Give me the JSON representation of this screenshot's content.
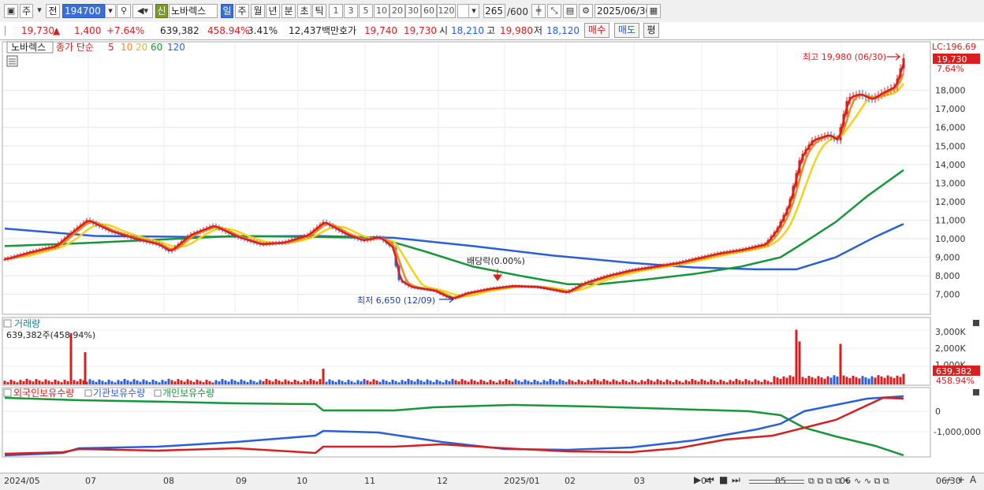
{
  "toolbar": {
    "period_label": "주",
    "prev_label": "전",
    "code": "194700",
    "badge": "신",
    "stock_name": "노바렉스",
    "periods": [
      "일",
      "주",
      "월",
      "년",
      "분",
      "초",
      "틱"
    ],
    "active_period": "일",
    "intervals": [
      "1",
      "3",
      "5",
      "10",
      "20",
      "30",
      "60",
      "120"
    ],
    "count": "265",
    "count_total": "/600",
    "date": "2025/06/30"
  },
  "quote": {
    "price": "19,730",
    "arrow": "▲",
    "change": "1,400",
    "change_pct": "+7.64%",
    "volume": "639,382",
    "volume_ratio": "458.94%",
    "turnover": "3.41%",
    "amount": "12,437백만",
    "bid_label": "호가",
    "bid": "19,740",
    "ask": "19,730",
    "open_label": "시",
    "open": "18,210",
    "high_label": "고",
    "high": "19,980",
    "low_label": "저",
    "low": "18,120",
    "buy_label": "매수",
    "sell_label": "매도",
    "avg_label": "평"
  },
  "price_panel": {
    "name": "노바렉스",
    "ma_label": "종가 단순",
    "ma_periods": [
      "5",
      "10",
      "20",
      "60",
      "120"
    ],
    "ma_colors": [
      "#d62020",
      "#f08a1e",
      "#f5d21a",
      "#17963a",
      "#2a5fd8"
    ],
    "lc_label": "LC:196.69",
    "current_tag": "19,730",
    "pct_tag": "7.64%",
    "high_annotation": "최고 19,980 (06/30)",
    "low_annotation": "최저 6,650 (12/09)",
    "dividend_annotation": "배당락(0.00%)",
    "y_ticks": [
      "18,000",
      "17,000",
      "16,000",
      "15,000",
      "14,000",
      "13,000",
      "12,000",
      "11,000",
      "10,000",
      "9,000",
      "8,000",
      "7,000"
    ],
    "up_color": "#d62020",
    "down_color": "#2a5fd8"
  },
  "volume_panel": {
    "title": "거래량",
    "readout": "639,382주(458.94%)",
    "y_ticks": [
      "3,000K",
      "2,000K",
      "1,000K"
    ],
    "current_tag": "639,382",
    "pct_tag": "458.94%"
  },
  "holdings_panel": {
    "legend": [
      "외국인보유수량",
      "기관보유수량",
      "개인보유수량"
    ],
    "legend_colors": [
      "#d62020",
      "#2a5fd8",
      "#17963a"
    ],
    "y_ticks": [
      "0",
      "-1,000,000"
    ]
  },
  "x_axis": [
    "2024/05",
    "07",
    "08",
    "09",
    "10",
    "11",
    "12",
    "2025/01",
    "02",
    "03",
    "04",
    "05",
    "06",
    "06/30"
  ]
}
